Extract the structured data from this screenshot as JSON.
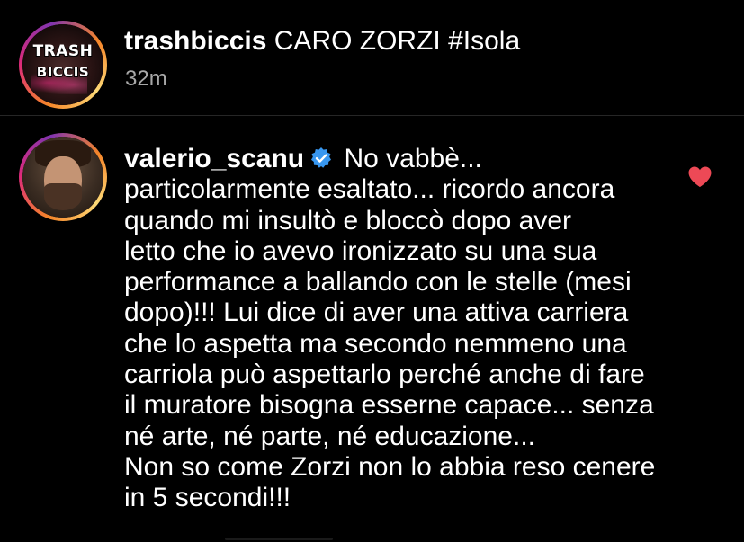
{
  "post": {
    "avatar": {
      "logo_line1": "TRASH",
      "logo_line2": "BICCIS"
    },
    "username": "trashbiccis",
    "caption": "CARO ZORZI #Isola",
    "time": "32m"
  },
  "comment": {
    "username": "valerio_scanu",
    "verified_icon": "verified-badge-icon",
    "first_line": "No vabbè...",
    "text": "particolarmente esaltato... ricordo ancora\nquando mi insultò e bloccò dopo aver\nletto che io avevo ironizzato su una sua\nperformance a ballando con le stelle (mesi\ndopo)!!! Lui dice di aver una attiva carriera\nche lo aspetta ma secondo nemmeno una\ncarriola può aspettarlo perché anche di fare\nil muratore bisogna esserne capace... senza\nné arte, né parte, né educazione...\nNon so come Zorzi non lo abbia reso cenere\nin 5 secondi!!!",
    "like_icon": "heart-icon",
    "like_color": "#ed4956"
  },
  "colors": {
    "background": "#000000",
    "text": "#ffffff",
    "secondary_text": "#a8a8a8",
    "verified_blue": "#3897f0",
    "divider": "#262626"
  }
}
